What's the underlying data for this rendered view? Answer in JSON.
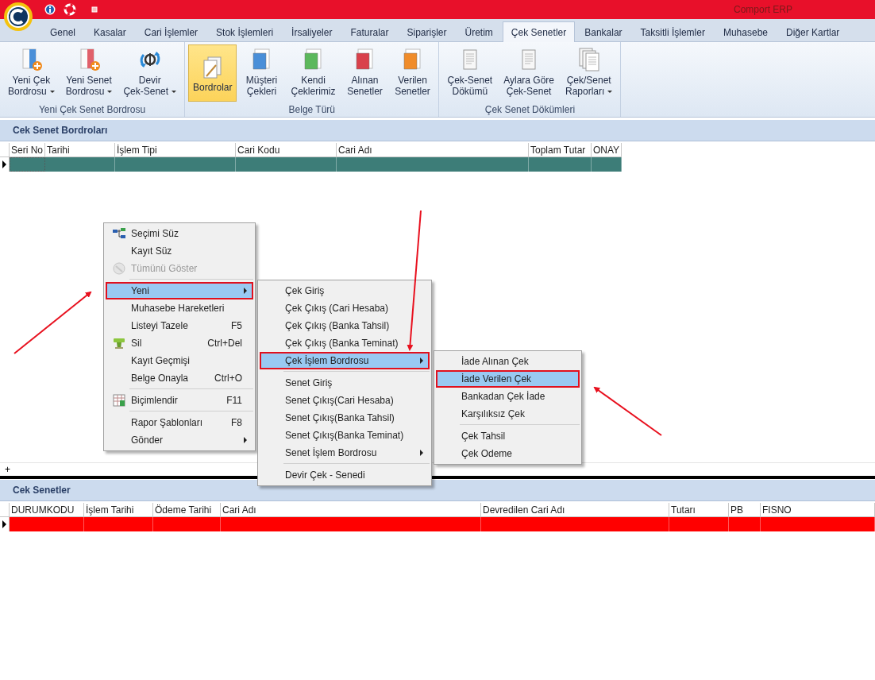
{
  "window": {
    "title": "Comport ERP"
  },
  "tabs": [
    {
      "label": "Genel",
      "selected": false
    },
    {
      "label": "Kasalar",
      "selected": false
    },
    {
      "label": "Cari İşlemler",
      "selected": false
    },
    {
      "label": "Stok İşlemleri",
      "selected": false
    },
    {
      "label": "İrsaliyeler",
      "selected": false
    },
    {
      "label": "Faturalar",
      "selected": false
    },
    {
      "label": "Siparişler",
      "selected": false
    },
    {
      "label": "Üretim",
      "selected": false
    },
    {
      "label": "Çek Senetler",
      "selected": true
    },
    {
      "label": "Bankalar",
      "selected": false
    },
    {
      "label": "Taksitli İşlemler",
      "selected": false
    },
    {
      "label": "Muhasebe",
      "selected": false
    },
    {
      "label": "Diğer Kartlar",
      "selected": false
    }
  ],
  "ribbon": [
    {
      "caption": "Yeni Çek Senet Bordrosu",
      "buttons": [
        {
          "kind": "new-doc",
          "color": "#4a8fd8",
          "lines": [
            "Yeni Çek",
            "Bordrosu"
          ],
          "dropdown": true,
          "selected": false
        },
        {
          "kind": "new-doc",
          "color": "#e0606a",
          "lines": [
            "Yeni Senet",
            "Bordrosu"
          ],
          "dropdown": true,
          "selected": false
        },
        {
          "kind": "transfer",
          "lines": [
            "Devir",
            "Çek-Senet"
          ],
          "dropdown": true,
          "selected": false
        }
      ]
    },
    {
      "caption": "Belge Türü",
      "buttons": [
        {
          "kind": "stack",
          "lines": [
            "Bordrolar"
          ],
          "dropdown": false,
          "selected": true
        },
        {
          "kind": "folder",
          "color": "#4a8fd8",
          "lines": [
            "Müşteri",
            "Çekleri"
          ],
          "dropdown": false,
          "selected": false
        },
        {
          "kind": "folder",
          "color": "#5cb85c",
          "lines": [
            "Kendi",
            "Çeklerimiz"
          ],
          "dropdown": false,
          "selected": false
        },
        {
          "kind": "folder",
          "color": "#d9414b",
          "lines": [
            "Alınan",
            "Senetler"
          ],
          "dropdown": false,
          "selected": false
        },
        {
          "kind": "folder",
          "color": "#f08c2a",
          "lines": [
            "Verilen",
            "Senetler"
          ],
          "dropdown": false,
          "selected": false
        }
      ]
    },
    {
      "caption": "Çek Senet Dökümleri",
      "buttons": [
        {
          "kind": "report",
          "lines": [
            "Çek-Senet",
            "Dökümü"
          ],
          "dropdown": false,
          "selected": false
        },
        {
          "kind": "report",
          "lines": [
            "Aylara Göre",
            "Çek-Senet"
          ],
          "dropdown": false,
          "selected": false
        },
        {
          "kind": "reports",
          "lines": [
            "Çek/Senet",
            "Raporları"
          ],
          "dropdown": true,
          "selected": false
        }
      ]
    }
  ],
  "top_panel": {
    "title": "Cek Senet Bordroları",
    "columns": [
      "Seri No",
      "Tarihi",
      "İşlem Tipi",
      "Cari Kodu",
      "Cari Adı",
      "Toplam Tutar",
      "ONAY"
    ],
    "rows": [
      {
        "color": "#3d7d78"
      }
    ],
    "footer_button": "+"
  },
  "bottom_panel": {
    "title": "Cek Senetler",
    "columns": [
      "DURUMKODU",
      "İşlem Tarihi",
      "Ödeme Tarihi",
      "Cari Adı",
      "Devredilen Cari Adı",
      "Tutarı",
      "PB",
      "FISNO"
    ],
    "rows": [
      {
        "color": "#ff0000"
      }
    ]
  },
  "context_menu": [
    {
      "kind": "filter",
      "label": "Seçimi Süz",
      "disabled": false,
      "selected": false
    },
    {
      "kind": "item",
      "label": "Kayıt Süz",
      "disabled": false,
      "selected": false
    },
    {
      "kind": "show-all",
      "label": "Tümünü Göster",
      "disabled": true,
      "selected": false
    },
    {
      "kind": "separator"
    },
    {
      "kind": "item",
      "label": "Yeni",
      "disabled": false,
      "selected": true,
      "submenu": true
    },
    {
      "kind": "item",
      "label": "Muhasebe Hareketleri",
      "disabled": false,
      "selected": false
    },
    {
      "kind": "item",
      "label": "Listeyi Tazele",
      "shortcut": "F5",
      "disabled": false,
      "selected": false
    },
    {
      "kind": "delete",
      "label": "Sil",
      "shortcut": "Ctrl+Del",
      "disabled": false,
      "selected": false
    },
    {
      "kind": "item",
      "label": "Kayıt Geçmişi",
      "disabled": false,
      "selected": false
    },
    {
      "kind": "item",
      "label": "Belge Onayla",
      "shortcut": "Ctrl+O",
      "disabled": false,
      "selected": false
    },
    {
      "kind": "separator"
    },
    {
      "kind": "format",
      "label": "Biçimlendir",
      "shortcut": "F11",
      "disabled": false,
      "selected": false
    },
    {
      "kind": "separator"
    },
    {
      "kind": "item",
      "label": "Rapor Şablonları",
      "shortcut": "F8",
      "disabled": false,
      "selected": false
    },
    {
      "kind": "item",
      "label": "Gönder",
      "disabled": false,
      "selected": false,
      "submenu": true
    }
  ],
  "submenu": [
    {
      "kind": "item",
      "label": "Çek Giriş",
      "disabled": false,
      "selected": false
    },
    {
      "kind": "item",
      "label": "Çek Çıkış (Cari Hesaba)",
      "disabled": false,
      "selected": false
    },
    {
      "kind": "item",
      "label": "Çek Çıkış (Banka Tahsil)",
      "disabled": false,
      "selected": false
    },
    {
      "kind": "item",
      "label": "Çek Çıkış (Banka Teminat)",
      "disabled": false,
      "selected": false
    },
    {
      "kind": "item",
      "label": "Çek İşlem Bordrosu",
      "disabled": false,
      "selected": true,
      "submenu": true
    },
    {
      "kind": "separator"
    },
    {
      "kind": "item",
      "label": "Senet Giriş",
      "disabled": false,
      "selected": false
    },
    {
      "kind": "item",
      "label": "Senet Çıkış(Cari Hesaba)",
      "disabled": false,
      "selected": false
    },
    {
      "kind": "item",
      "label": "Senet Çıkış(Banka Tahsil)",
      "disabled": false,
      "selected": false
    },
    {
      "kind": "item",
      "label": "Senet Çıkış(Banka Teminat)",
      "disabled": false,
      "selected": false
    },
    {
      "kind": "item",
      "label": "Senet İşlem Bordrosu",
      "disabled": false,
      "selected": false,
      "submenu": true
    },
    {
      "kind": "separator"
    },
    {
      "kind": "item",
      "label": "Devir Çek - Senedi",
      "disabled": false,
      "selected": false
    }
  ],
  "sub_submenu": [
    {
      "kind": "item",
      "label": "İade Alınan Çek",
      "disabled": false,
      "selected": false
    },
    {
      "kind": "item",
      "label": "İade Verilen Çek",
      "disabled": false,
      "selected": true
    },
    {
      "kind": "item",
      "label": "Bankadan Çek İade",
      "disabled": false,
      "selected": false
    },
    {
      "kind": "item",
      "label": "Karşılıksız Çek",
      "disabled": false,
      "selected": false
    },
    {
      "kind": "separator"
    },
    {
      "kind": "item",
      "label": "Çek Tahsil",
      "disabled": false,
      "selected": false
    },
    {
      "kind": "item",
      "label": "Çek Odeme",
      "disabled": false,
      "selected": false
    }
  ]
}
